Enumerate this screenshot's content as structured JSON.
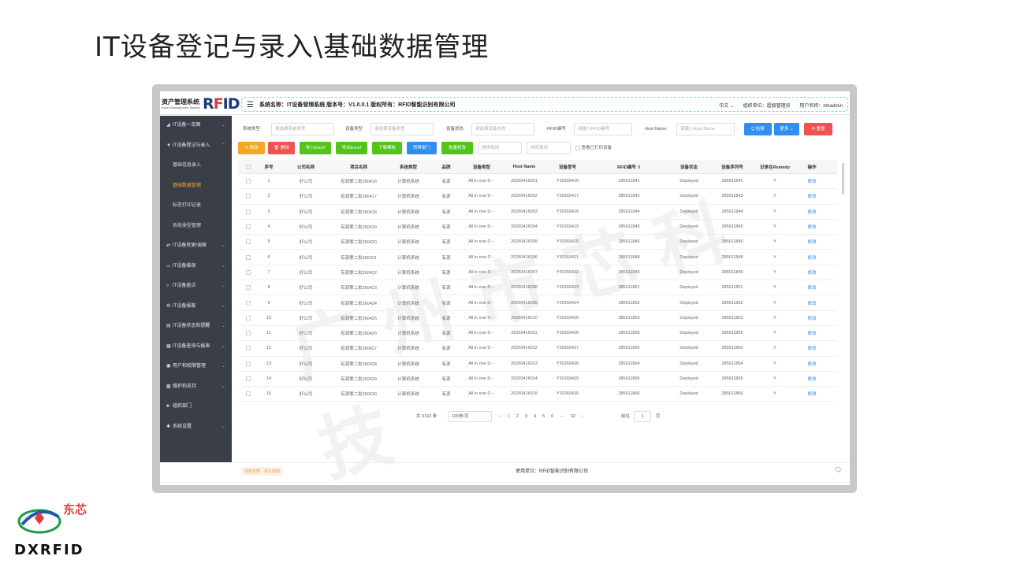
{
  "slide_title": "IT设备登记与录入\\基础数据管理",
  "logo": {
    "cn": "资产管理系统",
    "en": "Asset Management System",
    "rfid_pre": "R",
    "rfid_f": "F",
    "rfid_post": "ID"
  },
  "header": {
    "system_info": "系统名称：IT设备管理系统   版本号：V1.0.0.1   版权所有：RFID智能识别有限公司",
    "language": "中文",
    "org": "组织单位：超级管理员",
    "user": "用户名称：mhadmin"
  },
  "sidebar": {
    "items": [
      {
        "icon": "◢",
        "label": "IT设备一览图",
        "chev": "⌄"
      },
      {
        "icon": "▼",
        "label": "IT设备登记与录入",
        "chev": "⌃"
      },
      {
        "icon": "",
        "label": "基础信息录入",
        "sub": true
      },
      {
        "icon": "",
        "label": "基础数据管理",
        "sub": true,
        "active": true
      },
      {
        "icon": "",
        "label": "标签打印记录",
        "sub": true
      },
      {
        "icon": "",
        "label": "系统类型管理",
        "sub": true
      },
      {
        "icon": "⇄",
        "label": "IT设备变更/调拨",
        "chev": "⌄"
      },
      {
        "icon": "▭",
        "label": "IT设备维保",
        "chev": "⌄"
      },
      {
        "icon": "⌕",
        "label": "IT设备盘点",
        "chev": "⌄"
      },
      {
        "icon": "♻",
        "label": "IT设备报废",
        "chev": "⌄"
      },
      {
        "icon": "▤",
        "label": "IT设备状态和提醒",
        "chev": "⌄"
      },
      {
        "icon": "▦",
        "label": "IT设备查询与报表",
        "chev": "⌄"
      },
      {
        "icon": "▣",
        "label": "用户和权限管理",
        "chev": "⌄"
      },
      {
        "icon": "▩",
        "label": "维护和支持",
        "chev": "⌄"
      },
      {
        "icon": "♣",
        "label": "组织部门",
        "chev": ""
      },
      {
        "icon": "✱",
        "label": "系统设置",
        "chev": "⌄"
      }
    ]
  },
  "filters": {
    "system_type_label": "系统类型",
    "system_type_ph": "请选择系统类型",
    "device_type_label": "设备类型",
    "device_type_ph": "请选择设备类型",
    "device_status_label": "设备状态",
    "device_status_ph": "请选择设备状态",
    "rfid_label": "RFID编号",
    "rfid_ph": "请输入RFID编号",
    "hostname_label": "Host Name",
    "hostname_ph": "请输入Host Name",
    "search": "Q 检索",
    "more": "更多 ⌄",
    "reset": "⟲ 重置"
  },
  "actions": {
    "edit": "✎ 修改",
    "delete": "🗑 删除",
    "import": "导入Excel",
    "export": "导出Excel",
    "download_template": "下载模板",
    "transfer": "转移部门",
    "batch_edit": "批量修改",
    "sort1": "排序规则",
    "sort2": "排序规则",
    "view_printed": "查看已打印设备"
  },
  "table": {
    "headers": [
      "",
      "序号",
      "公司名称",
      "项目名称",
      "系统类型",
      "品牌",
      "设备类型",
      "Host Name",
      "设备型号",
      "RFID编号 ⇕",
      "设备状态",
      "设备序列号",
      "记录在Remedy",
      "操作"
    ],
    "rows": [
      [
        "",
        "1",
        "好公司",
        "有源第二批260416",
        "计算机系统",
        "有源",
        "All in one D···",
        "20260416001",
        "Y20260416",
        "285611841",
        "Deployed",
        "285611841",
        "Y",
        "修改"
      ],
      [
        "",
        "2",
        "好公司",
        "有源第二批260417",
        "计算机系统",
        "有源",
        "All in one D···",
        "20260416002",
        "Y20260417",
        "285611843",
        "Deployed",
        "285611843",
        "Y",
        "修改"
      ],
      [
        "",
        "3",
        "好公司",
        "有源第二批260418",
        "计算机系统",
        "有源",
        "All in one D···",
        "20260416003",
        "Y20260418",
        "285611844",
        "Deployed",
        "285611844",
        "Y",
        "修改"
      ],
      [
        "",
        "4",
        "好公司",
        "有源第二批260419",
        "计算机系统",
        "有源",
        "All in one D···",
        "20260416004",
        "Y20260419",
        "285611845",
        "Deployed",
        "285611845",
        "Y",
        "修改"
      ],
      [
        "",
        "5",
        "好公司",
        "有源第二批260420",
        "计算机系统",
        "有源",
        "All in one D···",
        "20260416005",
        "Y20260420",
        "285611846",
        "Deployed",
        "285611846",
        "Y",
        "修改"
      ],
      [
        "",
        "6",
        "好公司",
        "有源第二批260421",
        "计算机系统",
        "有源",
        "All in one D···",
        "20260416006",
        "Y20260421",
        "285611848",
        "Deployed",
        "285611848",
        "Y",
        "修改"
      ],
      [
        "",
        "7",
        "好公司",
        "有源第二批260422",
        "计算机系统",
        "有源",
        "All in one D···",
        "20260416007",
        "Y20260422",
        "285611849",
        "Deployed",
        "285611849",
        "Y",
        "修改"
      ],
      [
        "",
        "8",
        "好公司",
        "有源第二批260423",
        "计算机系统",
        "有源",
        "All in one D···",
        "20260416008",
        "Y20260423",
        "285611851",
        "Deployed",
        "285611851",
        "Y",
        "修改"
      ],
      [
        "",
        "9",
        "好公司",
        "有源第二批260424",
        "计算机系统",
        "有源",
        "All in one D···",
        "20260416009",
        "Y20260424",
        "285611852",
        "Deployed",
        "285611852",
        "Y",
        "修改"
      ],
      [
        "",
        "10",
        "好公司",
        "有源第二批260425",
        "计算机系统",
        "有源",
        "All in one D···",
        "20260416010",
        "Y20260425",
        "285611853",
        "Deployed",
        "285611853",
        "Y",
        "修改"
      ],
      [
        "",
        "11",
        "好公司",
        "有源第二批260426",
        "计算机系统",
        "有源",
        "All in one D···",
        "20260416011",
        "Y20260426",
        "285611859",
        "Deployed",
        "285611859",
        "Y",
        "修改"
      ],
      [
        "",
        "12",
        "好公司",
        "有源第二批260427",
        "计算机系统",
        "有源",
        "All in one D···",
        "20260416012",
        "Y20260427",
        "285611860",
        "Deployed",
        "285611860",
        "Y",
        "修改"
      ],
      [
        "",
        "13",
        "好公司",
        "有源第二批260428",
        "计算机系统",
        "有源",
        "All in one D···",
        "20260416013",
        "Y20260428",
        "285611864",
        "Deployed",
        "285611864",
        "Y",
        "修改"
      ],
      [
        "",
        "14",
        "好公司",
        "有源第二批260429",
        "计算机系统",
        "有源",
        "All in one D···",
        "20260416014",
        "Y20260429",
        "285611865",
        "Deployed",
        "285611865",
        "Y",
        "修改"
      ],
      [
        "",
        "15",
        "好公司",
        "有源第二批260430",
        "计算机系统",
        "有源",
        "All in one D···",
        "20260416015",
        "Y20260430",
        "285611866",
        "Deployed",
        "285611866",
        "Y",
        "修改"
      ]
    ]
  },
  "pager": {
    "total": "共 3192 条",
    "page_size": "100条/页",
    "pages": [
      "‹",
      "1",
      "2",
      "3",
      "4",
      "5",
      "6",
      "···",
      "32",
      "›"
    ],
    "goto": "前往",
    "goto_value": "1",
    "page_word": "页"
  },
  "footer": {
    "license": "授权性质：永久授权",
    "owner": "使用单位：RFID智能识别有限公司",
    "msg_icon": "🗨"
  },
  "watermark": "广州市芯科技",
  "corner_logo": {
    "cn": "东芯",
    "en": "DXRFID"
  }
}
